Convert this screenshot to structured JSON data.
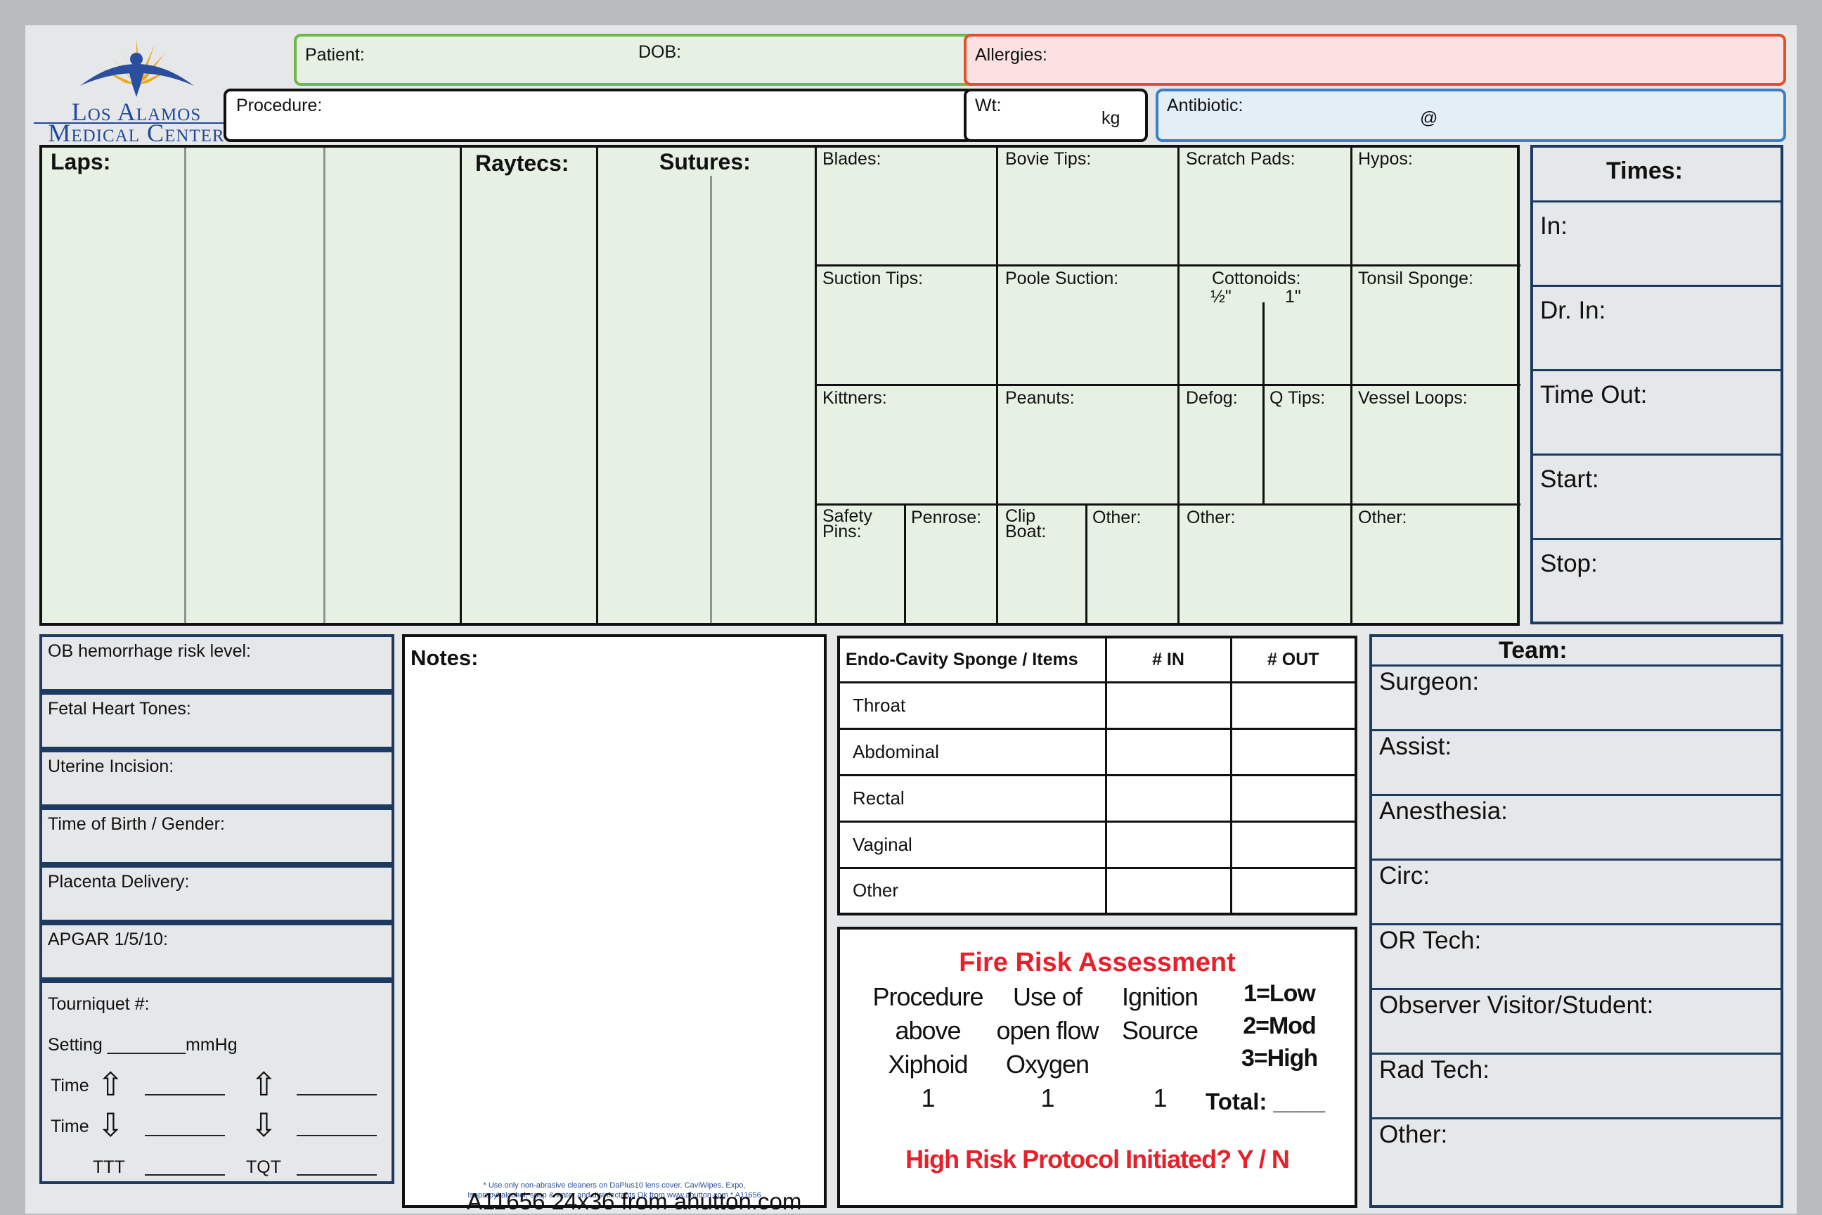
{
  "logo": {
    "line1": "Los Alamos",
    "line2": "Medical Center",
    "star_color": "#e9a81f",
    "figure_color": "#2a4f9e"
  },
  "header": {
    "patient_label": "Patient:",
    "dob_label": "DOB:",
    "allergies_label": "Allergies:",
    "procedure_label": "Procedure:",
    "wt_label": "Wt:",
    "wt_unit": "kg",
    "antibiotic_label": "Antibiotic:",
    "antibiotic_at": "@"
  },
  "counts": {
    "laps": "Laps:",
    "raytecs": "Raytecs:",
    "sutures": "Sutures:",
    "grid": {
      "blades": "Blades:",
      "bovie_tips": "Bovie Tips:",
      "scratch_pads": "Scratch Pads:",
      "hypos": "Hypos:",
      "suction_tips": "Suction Tips:",
      "poole_suction": "Poole Suction:",
      "cottonoids": "Cottonoids:",
      "cottonoids_half": "½\"",
      "cottonoids_one": "1\"",
      "tonsil_sponge": "Tonsil Sponge:",
      "kittners": "Kittners:",
      "peanuts": "Peanuts:",
      "defog": "Defog:",
      "q_tips": "Q Tips:",
      "vessel_loops": "Vessel Loops:",
      "safety_pins_1": "Safety",
      "safety_pins_2": "Pins:",
      "penrose": "Penrose:",
      "clip_boat_1": "Clip",
      "clip_boat_2": "Boat:",
      "other_a": "Other:",
      "other_b": "Other:",
      "other_c": "Other:"
    }
  },
  "times": {
    "title": "Times:",
    "rows": [
      "In:",
      "Dr. In:",
      "Time Out:",
      "Start:",
      "Stop:"
    ]
  },
  "ob": {
    "rows": [
      "OB hemorrhage risk level:",
      "Fetal Heart Tones:",
      "Uterine Incision:",
      "Time of Birth / Gender:",
      "Placenta Delivery:",
      "APGAR 1/5/10:"
    ],
    "tourniquet": "Tourniquet #:",
    "setting": "Setting ________mmHg",
    "time_up": "Time",
    "time_down": "Time",
    "ttt": "TTT",
    "tqt": "TQT",
    "arrow_up": "⇧",
    "arrow_down": "⇩"
  },
  "notes": {
    "title": "Notes:",
    "footnote_1": "* Use only non-abrasive cleaners on DaPlus10 lens cover.  CaviWipes, Expo,",
    "footnote_2": "Isopropyl alcohol, soap & water and disinfectants Ok from www.ahutton.com * A11656"
  },
  "endo": {
    "headers": [
      "Endo-Cavity Sponge / Items",
      "# IN",
      "# OUT"
    ],
    "rows": [
      "Throat",
      "Abdominal",
      "Rectal",
      "Vaginal",
      "Other"
    ]
  },
  "fire": {
    "title": "Fire Risk Assessment",
    "col1": [
      "Procedure",
      "above",
      "Xiphoid",
      "1"
    ],
    "col2": [
      "Use of",
      "open flow",
      "Oxygen",
      "1"
    ],
    "col3": [
      "Ignition",
      "Source",
      "",
      "1"
    ],
    "scale": [
      "1=Low",
      "2=Mod",
      "3=High"
    ],
    "total": "Total: ____",
    "protocol": "High Risk Protocol Initiated?  Y / N",
    "accent": "#e8202a"
  },
  "team": {
    "title": "Team:",
    "rows": [
      "Surgeon:",
      "Assist:",
      "Anesthesia:",
      "Circ:",
      "OR Tech:",
      "Observer Visitor/Student:",
      "Rad Tech:",
      "Other:"
    ]
  },
  "footer": "A11656  24x36  from ahutton.com"
}
